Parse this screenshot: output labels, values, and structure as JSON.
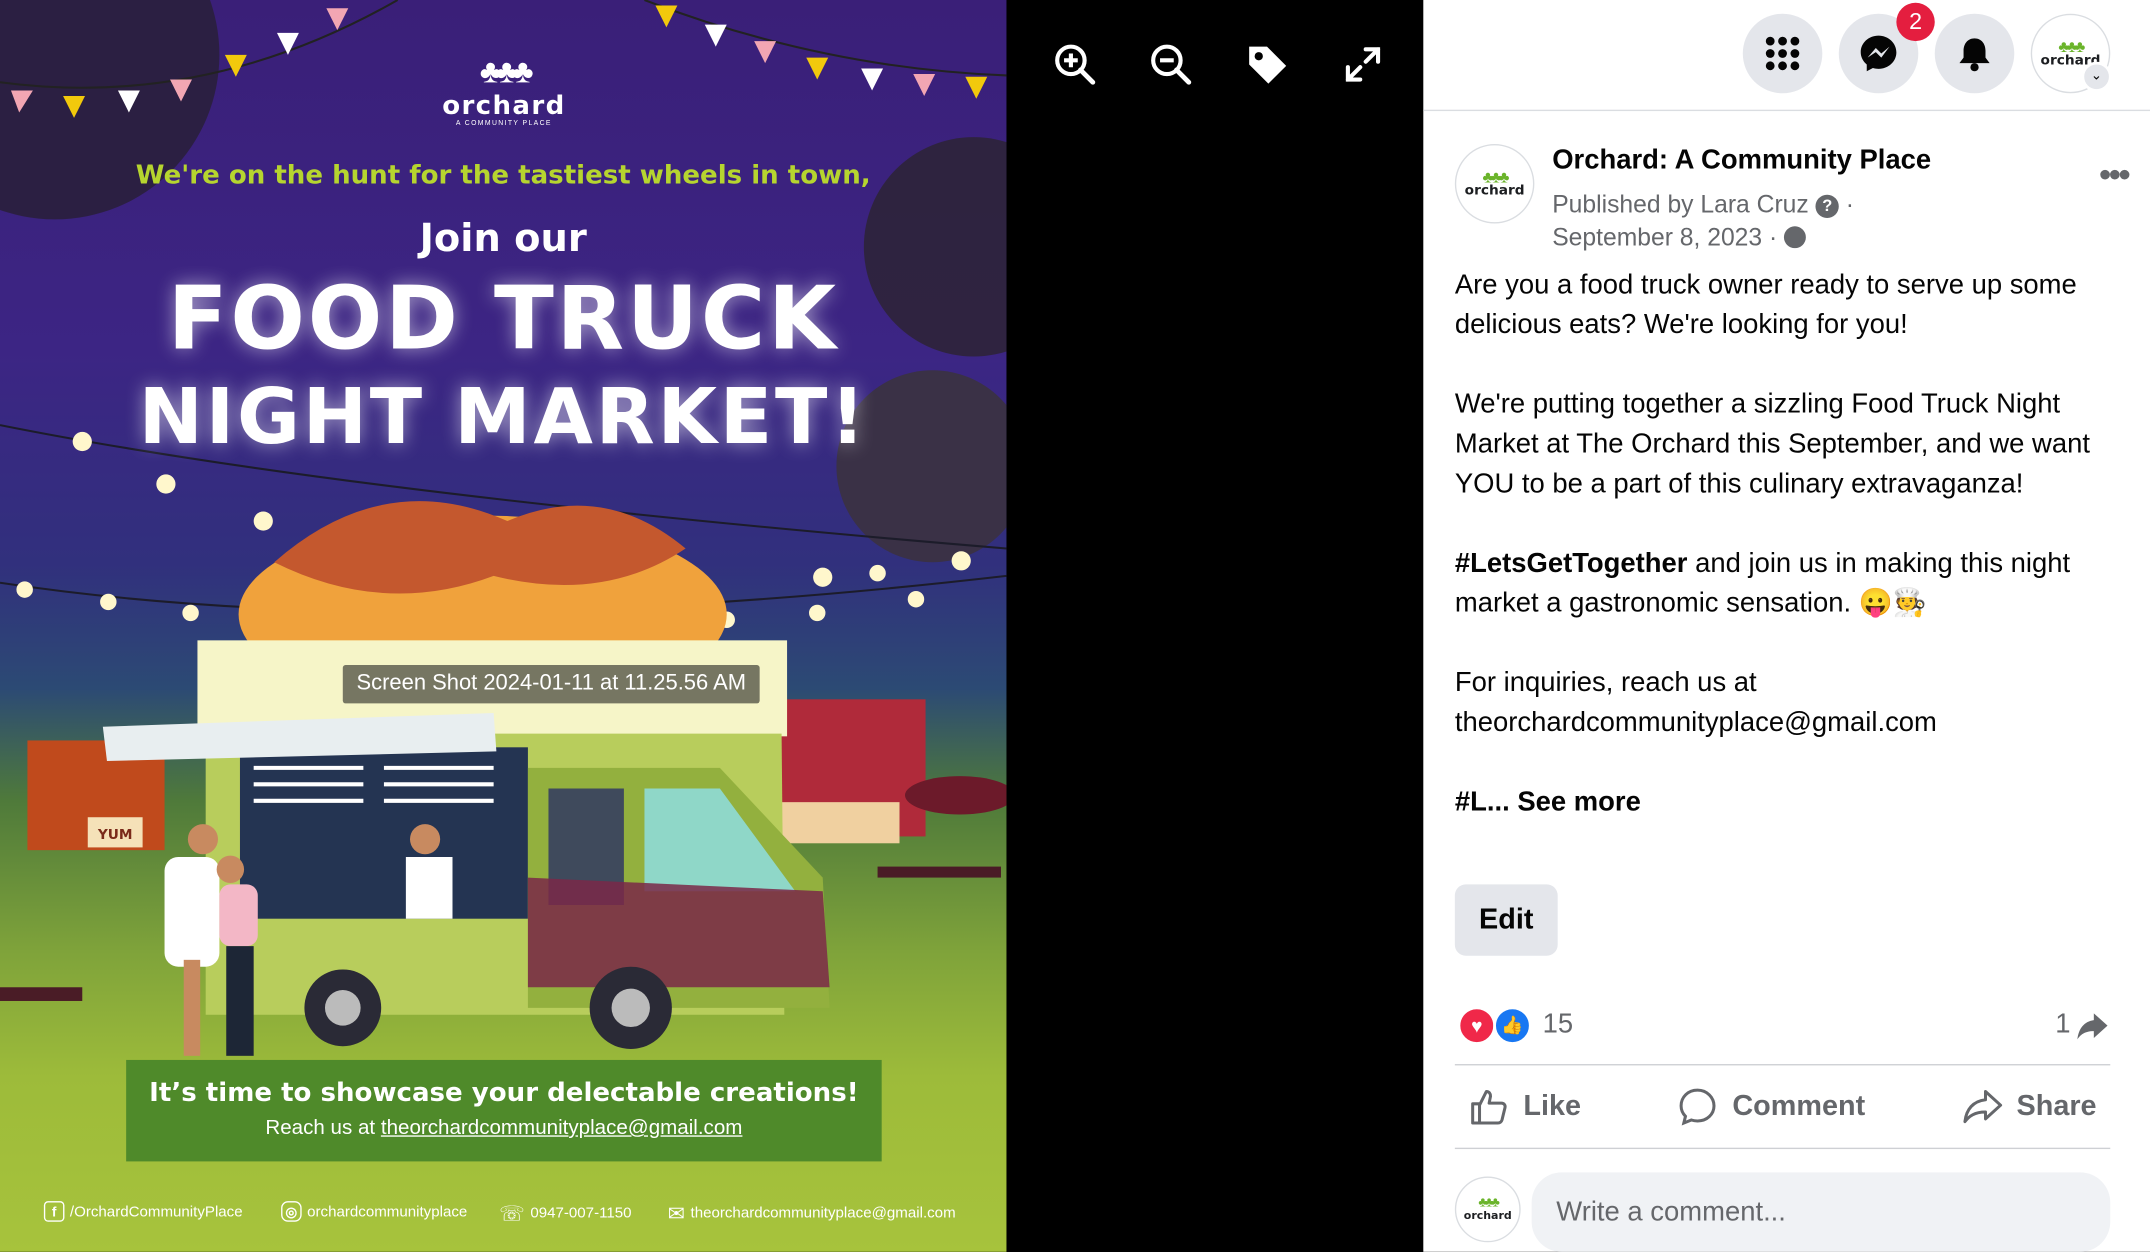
{
  "viewer": {
    "tooltip": "Screen Shot 2024-01-11 at 11.25.56 AM",
    "toolbar": [
      "zoom-in-icon",
      "zoom-out-icon",
      "tag-icon",
      "fullscreen-icon"
    ]
  },
  "poster": {
    "logo_word": "orchard",
    "logo_sub": "A COMMUNITY PLACE",
    "hunt": "We're on the hunt for the tastiest wheels in town,",
    "join": "Join our",
    "title_line1": "FOOD TRUCK",
    "title_line2": "NIGHT MARKET!",
    "banner_line1": "It’s time to showcase your delectable creations!",
    "banner_reach": "Reach us at",
    "banner_email": "theorchardcommunityplace@gmail.com",
    "truck_sign": "YUM",
    "footer_facebook": "/OrchardCommunityPlace",
    "footer_instagram": "orchardcommunityplace",
    "footer_phone": "0947-007-1150",
    "footer_email": "theorchardcommunityplace@gmail.com"
  },
  "topbar": {
    "messenger_badge": "2",
    "avatar_word": "orchard"
  },
  "post": {
    "page_name": "Orchard: A Community Place",
    "avatar_word": "orchard",
    "published_by": "Published by Lara Cruz",
    "date": "September 8, 2023",
    "p1": "Are you a food truck owner ready to serve up some delicious eats? We're looking for you!",
    "p2": "We're putting together a sizzling Food Truck Night Market at The Orchard this September, and we want YOU to be a part of this culinary extravaganza!",
    "p3_tag": "#LetsGetTogether",
    "p3_rest": " and join us in making this night market a gastronomic sensation. 😛🧑‍🍳",
    "p4_line1": "For inquiries, reach us at",
    "p4_email": "theorchardcommunityplace@gmail.com",
    "p5_tag": "#L...",
    "see_more": "See more",
    "edit_label": "Edit",
    "reaction_count": "15",
    "share_count": "1",
    "like_label": "Like",
    "comment_label": "Comment",
    "share_label": "Share",
    "comment_placeholder": "Write a comment..."
  }
}
